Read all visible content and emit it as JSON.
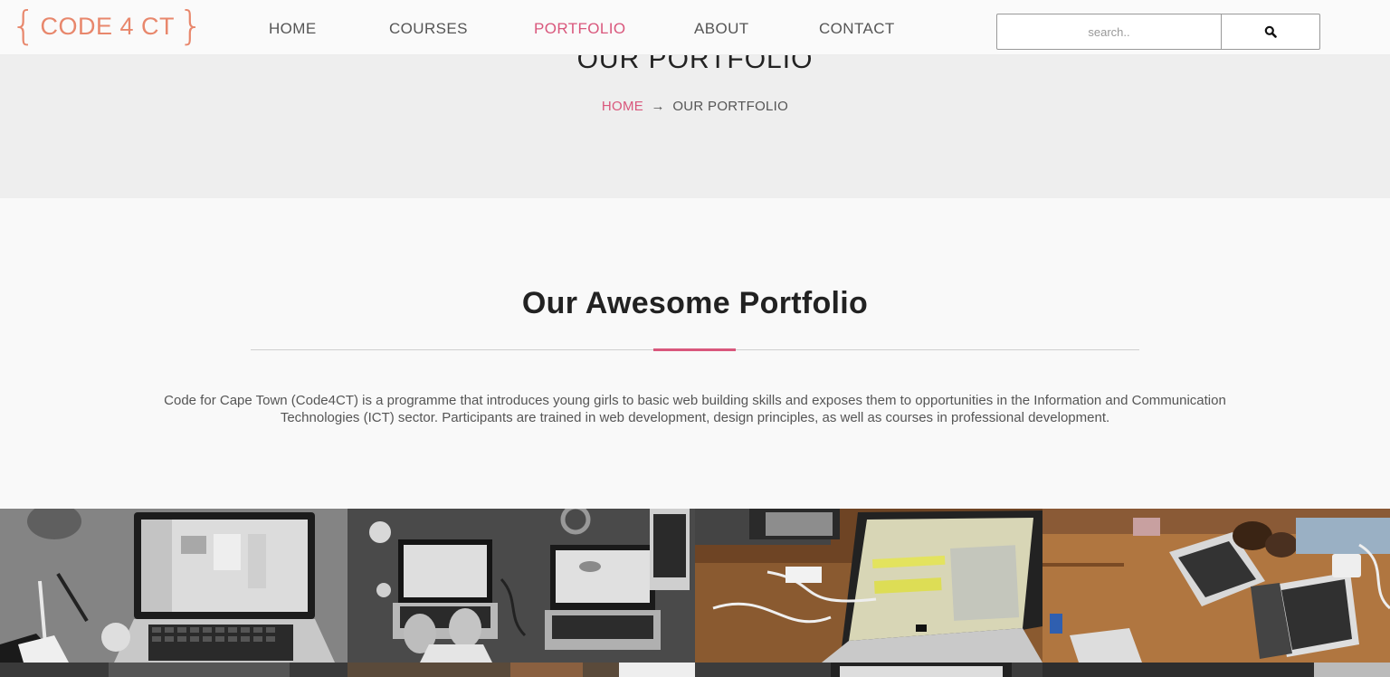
{
  "brand": {
    "logo_text": "CODE 4 CT",
    "brace_open": "{",
    "brace_close": "}",
    "color": "#e8876c"
  },
  "nav": {
    "items": [
      {
        "label": "HOME"
      },
      {
        "label": "COURSES"
      },
      {
        "label": "PORTFOLIO",
        "active": true
      },
      {
        "label": "ABOUT"
      },
      {
        "label": "CONTACT"
      }
    ],
    "active_color": "#d9577c"
  },
  "search": {
    "placeholder": "search..",
    "button_icon": "search-icon"
  },
  "banner": {
    "title": "OUR PORTFOLIO",
    "breadcrumb_home": "HOME",
    "breadcrumb_arrow": "→",
    "breadcrumb_current": "OUR PORTFOLIO"
  },
  "section": {
    "title": "Our Awesome Portfolio",
    "intro": "Code for Cape Town (Code4CT) is a programme that introduces young girls to basic web building skills and exposes them to opportunities in the Information and Communication Technologies (ICT) sector. Participants are trained in web development, design principles, as well as courses in professional development.",
    "accent_color": "#d9577c"
  },
  "gallery": {
    "tiles": [
      {
        "description": "grayscale photo of laptop on desk with pens"
      },
      {
        "description": "grayscale photo of two laptops and hands typing"
      },
      {
        "description": "color photo of laptop on wooden table with cables"
      },
      {
        "description": "color photo of people with laptops at wooden table"
      }
    ]
  }
}
